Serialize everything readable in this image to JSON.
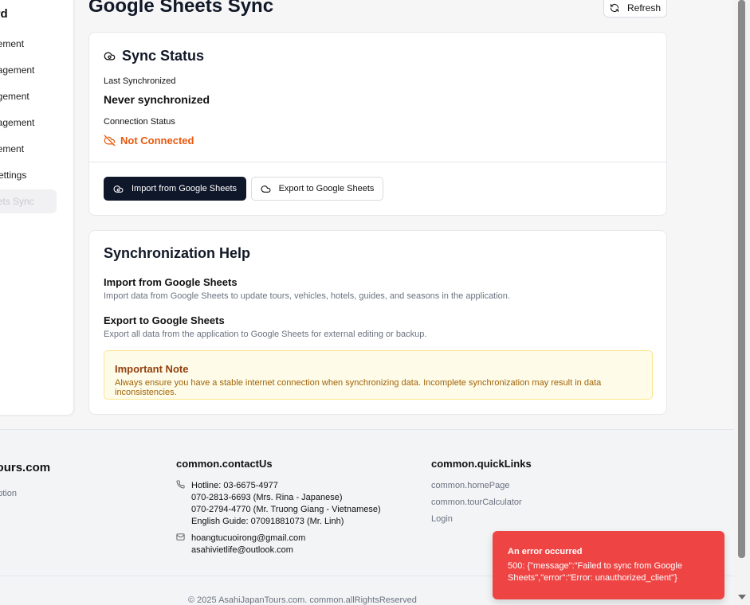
{
  "sidebar": {
    "title": "board",
    "items": [
      {
        "label": "gement"
      },
      {
        "label": "nagement"
      },
      {
        "label": "agement"
      },
      {
        "label": "nagement"
      },
      {
        "label": "gement"
      },
      {
        "label": "Settings"
      },
      {
        "label": "eets Sync"
      }
    ]
  },
  "header": {
    "title": "Google Sheets Sync",
    "refresh_label": "Refresh"
  },
  "sync_status": {
    "title": "Sync Status",
    "last_sync_label": "Last Synchronized",
    "last_sync_value": "Never synchronized",
    "connection_label": "Connection Status",
    "connection_value": "Not Connected",
    "import_button": "Import from Google Sheets",
    "export_button": "Export to Google Sheets"
  },
  "help": {
    "title": "Synchronization Help",
    "import_title": "Import from Google Sheets",
    "import_desc": "Import data from Google Sheets to update tours, vehicles, hotels, guides, and seasons in the application.",
    "export_title": "Export to Google Sheets",
    "export_desc": "Export all data from the application to Google Sheets for external editing or backup.",
    "note_title": "Important Note",
    "note_desc": "Always ensure you have a stable internet connection when synchronizing data. Incomplete synchronization may result in data inconsistencies."
  },
  "footer": {
    "brand": "anTours.com",
    "brand_desc": "scription",
    "contact_title": "common.contactUs",
    "phones": [
      "Hotline: 03-6675-4977",
      "070-2813-6693 (Mrs. Rina - Japanese)",
      "070-2794-4770 (Mr. Truong Giang - Vietnamese)",
      "English Guide: 07091881073 (Mr. Linh)"
    ],
    "emails": [
      "hoangtucuoirong@gmail.com",
      "asahivietlife@outlook.com"
    ],
    "quicklinks_title": "common.quickLinks",
    "quicklinks": [
      "common.homePage",
      "common.tourCalculator",
      "Login"
    ],
    "copyright": "© 2025 AsahiJapanTours.com. common.allRightsReserved"
  },
  "toast": {
    "title": "An error occurred",
    "message": "500: {\"message\":\"Failed to sync from Google Sheets\",\"error\":\"Error: unauthorized_client\"}"
  },
  "colors": {
    "primary": "#0f172a",
    "warning": "#ea580c",
    "error": "#ef4444",
    "note_bg": "#fefce8"
  }
}
